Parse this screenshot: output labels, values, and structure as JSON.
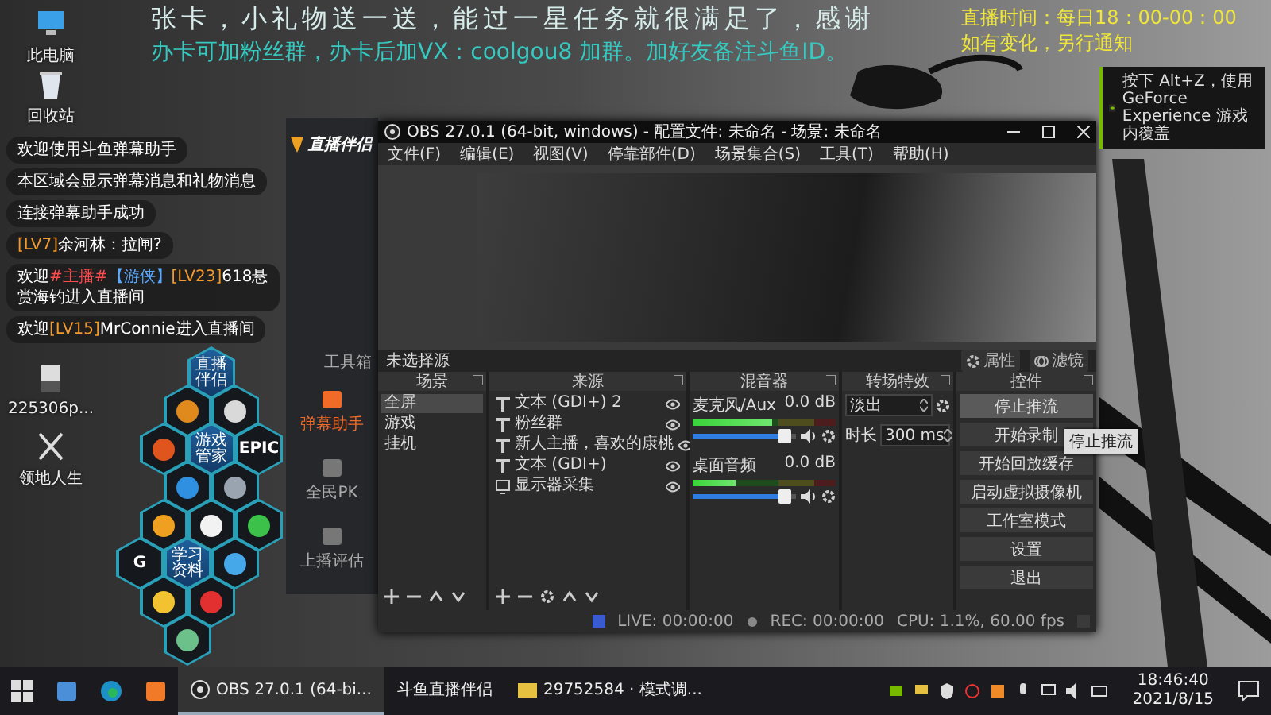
{
  "desktop_icons": [
    {
      "label": "此电脑",
      "kind": "computer"
    },
    {
      "label": "回收站",
      "kind": "bin"
    },
    {
      "label": "225306p...",
      "kind": "file"
    },
    {
      "label": "领地人生",
      "kind": "game"
    }
  ],
  "stream_overlay": {
    "notice_lines": [
      "张卡，小礼物送一送，能过一星任务就很满足了，感谢",
      "办卡可加粉丝群，办卡后加VX：coolgou8 加群。加好友备注斗鱼ID。"
    ],
    "schedule_lines": [
      "直播时间：每日18：00-00：00",
      "如有变化，另行通知"
    ]
  },
  "danmaku_chat": [
    {
      "parts": [
        {
          "text": "欢迎使用斗鱼弹幕助手",
          "kind": "plain"
        }
      ]
    },
    {
      "parts": [
        {
          "text": "本区域会显示弹幕消息和礼物消息",
          "kind": "plain"
        }
      ]
    },
    {
      "parts": [
        {
          "text": "连接弹幕助手成功",
          "kind": "plain"
        }
      ]
    },
    {
      "parts": [
        {
          "text": "[LV7]",
          "kind": "level"
        },
        {
          "text": "余河林：拉闸?",
          "kind": "plain"
        }
      ]
    },
    {
      "parts": [
        {
          "text": "欢迎",
          "kind": "plain"
        },
        {
          "text": "#主播#",
          "kind": "host"
        },
        {
          "text": "【游侠】",
          "kind": "badge"
        },
        {
          "text": "[LV23]",
          "kind": "level"
        },
        {
          "text": "618悬赏海钓进入直播间",
          "kind": "plain"
        }
      ]
    },
    {
      "parts": [
        {
          "text": "欢迎",
          "kind": "plain"
        },
        {
          "text": "[LV15]",
          "kind": "level"
        },
        {
          "text": "MrConnie进入直播间",
          "kind": "plain"
        }
      ]
    }
  ],
  "launcher_tiles": [
    {
      "kind": "label",
      "label": "直播伴侣"
    },
    {
      "kind": "app",
      "color": "#e08a1e"
    },
    {
      "kind": "app",
      "color": "#d9d9d9"
    },
    {
      "kind": "app",
      "color": "#e0541e"
    },
    {
      "kind": "label",
      "label": "游戏管家"
    },
    {
      "kind": "logo",
      "label": "EPIC"
    },
    {
      "kind": "app",
      "color": "#2f8fe0"
    },
    {
      "kind": "app",
      "color": "#9aa4b0"
    },
    {
      "kind": "app",
      "color": "#f0a020"
    },
    {
      "kind": "app",
      "color": "#f2f2f2"
    },
    {
      "kind": "app",
      "color": "#3cc24a"
    },
    {
      "kind": "logo",
      "label": "G"
    },
    {
      "kind": "label",
      "label": "学习资料"
    },
    {
      "kind": "app",
      "color": "#45a8e8"
    },
    {
      "kind": "app",
      "color": "#f2c230"
    },
    {
      "kind": "app",
      "color": "#e23030"
    },
    {
      "kind": "app",
      "color": "#6cc08a"
    }
  ],
  "douyu_window": {
    "logo": "直播伴侣",
    "section": "工具箱",
    "tools": [
      {
        "label": "弹幕助手",
        "selected": true
      },
      {
        "label": "全民PK",
        "selected": false
      },
      {
        "label": "上播评估",
        "selected": false
      }
    ]
  },
  "obs": {
    "title": "OBS 27.0.1 (64-bit, windows) - 配置文件: 未命名 - 场景: 未命名",
    "menu": [
      "文件(F)",
      "编辑(E)",
      "视图(V)",
      "停靠部件(D)",
      "场景集合(S)",
      "工具(T)",
      "帮助(H)"
    ],
    "source_bar": {
      "status": "未选择源",
      "buttons": [
        {
          "label": "属性",
          "kind": "properties"
        },
        {
          "label": "滤镜",
          "kind": "filters"
        }
      ]
    },
    "scenes": {
      "title": "场景",
      "items": [
        {
          "name": "全屏",
          "selected": true
        },
        {
          "name": "游戏",
          "selected": false
        },
        {
          "name": "挂机",
          "selected": false
        }
      ]
    },
    "sources": {
      "title": "来源",
      "items": [
        {
          "name": "文本 (GDI+) 2",
          "kind": "text"
        },
        {
          "name": "粉丝群",
          "kind": "text"
        },
        {
          "name": "新人主播，喜欢的康桃",
          "kind": "text"
        },
        {
          "name": "文本 (GDI+)",
          "kind": "text"
        },
        {
          "name": "显示器采集",
          "kind": "display"
        }
      ]
    },
    "mixer": {
      "title": "混音器",
      "channels": [
        {
          "name": "麦克风/Aux",
          "reading": "0.0 dB",
          "meter": {
            "level": 0.55
          },
          "volume": {
            "level": 0.95
          }
        },
        {
          "name": "桌面音频",
          "reading": "0.0 dB",
          "meter": {
            "level": 0.3
          },
          "volume": {
            "level": 0.95
          }
        }
      ]
    },
    "transitions": {
      "title": "转场特效",
      "effect": "淡出",
      "duration_label": "时长",
      "duration": "300 ms"
    },
    "controls": {
      "title": "控件",
      "buttons": [
        {
          "label": "停止推流",
          "hovered": true
        },
        {
          "label": "开始录制",
          "hovered": false
        },
        {
          "label": "开始回放缓存",
          "hovered": false
        },
        {
          "label": "启动虚拟摄像机",
          "hovered": false
        },
        {
          "label": "工作室模式",
          "hovered": false
        },
        {
          "label": "设置",
          "hovered": false
        },
        {
          "label": "退出",
          "hovered": false
        }
      ],
      "tooltip": "停止推流"
    },
    "status_bar": {
      "live": "LIVE: 00:00:00",
      "rec": "REC: 00:00:00",
      "performance": "CPU: 1.1%, 60.00 fps"
    }
  },
  "nvidia_popup": {
    "text": "按下 Alt+Z，使用 GeForce Experience 游戏内覆盖"
  },
  "taskbar": {
    "tasks": [
      {
        "label": "OBS 27.0.1 (64-bi...",
        "kind": "obs",
        "selected": true
      },
      {
        "label": "斗鱼直播伴侣",
        "kind": "douyu",
        "selected": false
      },
      {
        "label": "29752584 · 模式调...",
        "kind": "folder",
        "selected": false
      }
    ],
    "clock": {
      "time": "18:46:40",
      "date": "2021/8/15"
    }
  }
}
